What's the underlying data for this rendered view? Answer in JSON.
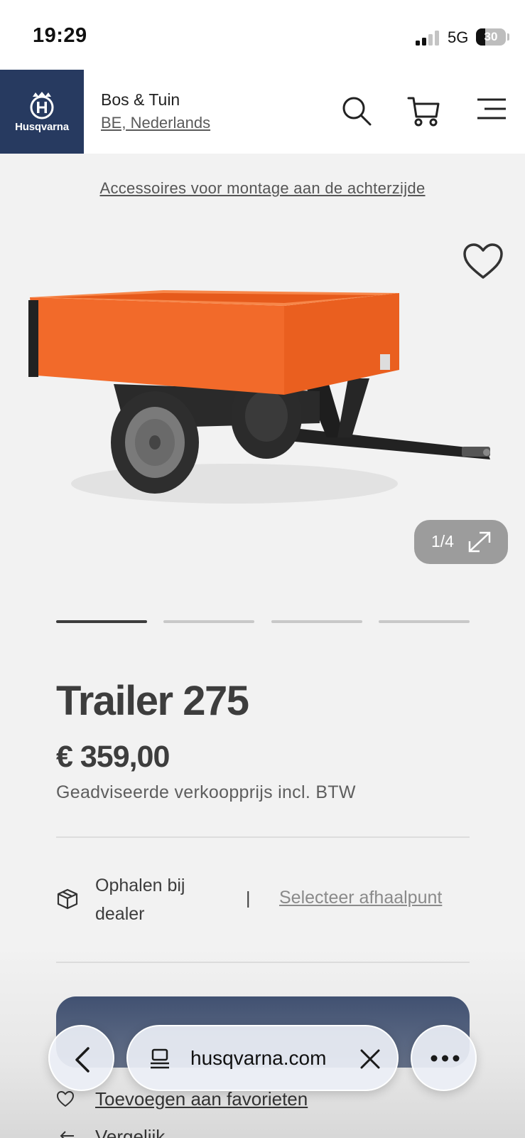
{
  "status_bar": {
    "time": "19:29",
    "network": "5G",
    "battery": "30",
    "battery_level": 0.3
  },
  "header": {
    "brand": "Husqvarna",
    "site_name": "Bos & Tuin",
    "locale": "BE, Nederlands",
    "icons": [
      "search-icon",
      "cart-icon",
      "menu-icon"
    ],
    "brand_color": "#273a60"
  },
  "breadcrumb": "Accessoires voor montage aan de achterzijde",
  "gallery": {
    "counter": "1/4",
    "current": 1,
    "total": 4
  },
  "product": {
    "title": "Trailer 275",
    "price": "€ 359,00",
    "price_note": "Geadviseerde verkoopprijs incl. BTW",
    "accent_color": "#f26a2a"
  },
  "pickup": {
    "label": "Ophalen bij dealer",
    "separator": "|",
    "link": "Selecteer afhaalpunt"
  },
  "actions": {
    "cta_label": "",
    "favorite": "Toevoegen aan favorieten",
    "compare": "Vergelijk"
  },
  "browser_bar": {
    "url": "husqvarna.com"
  }
}
